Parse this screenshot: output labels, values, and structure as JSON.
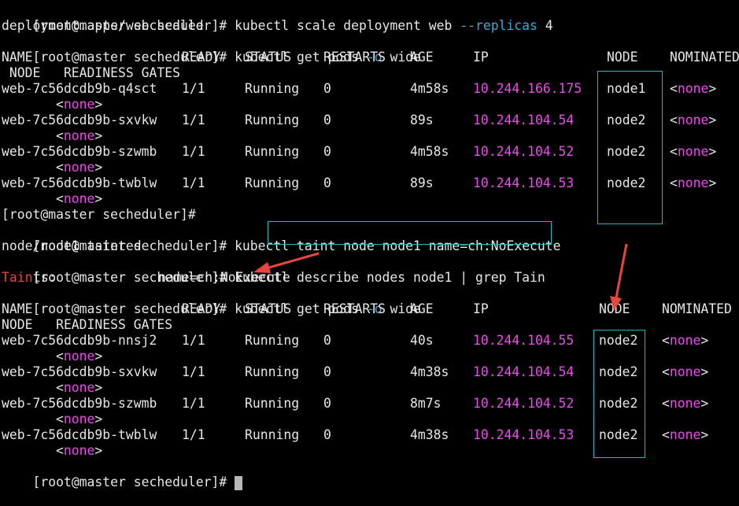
{
  "prompt": "[root@master secheduler]# ",
  "cmd1": "kubectl scale deployment web ",
  "cmd1_flag": "--replicas",
  "cmd1_arg": " 4",
  "out1": "deployment.apps/web scaled",
  "cmd2_a": "kubectl get pods ",
  "cmd2_flag": "-o",
  "cmd2_b": " wide",
  "header": {
    "name": "NAME",
    "ready": "READY",
    "status": "STATUS",
    "restarts": "RESTARTS",
    "age": "AGE",
    "ip": "IP",
    "node": "NODE",
    "nominated": "NOMINATED",
    "node2_top": " NODE   READINESS GATES",
    "node2_bottom": "NODE   READINESS GATES"
  },
  "table1": [
    {
      "name": "web-7c56dcdb9b-q4sct",
      "ready": "1/1",
      "status": "Running",
      "restarts": "0",
      "age": "4m58s",
      "ip": "10.244.166.175",
      "node": "node1",
      "nominated": "none"
    },
    {
      "name": "web-7c56dcdb9b-sxvkw",
      "ready": "1/1",
      "status": "Running",
      "restarts": "0",
      "age": "89s",
      "ip": "10.244.104.54",
      "node": "node2",
      "nominated": "none"
    },
    {
      "name": "web-7c56dcdb9b-szwmb",
      "ready": "1/1",
      "status": "Running",
      "restarts": "0",
      "age": "4m58s",
      "ip": "10.244.104.52",
      "node": "node2",
      "nominated": "none"
    },
    {
      "name": "web-7c56dcdb9b-twblw",
      "ready": "1/1",
      "status": "Running",
      "restarts": "0",
      "age": "89s",
      "ip": "10.244.104.53",
      "node": "node2",
      "nominated": "none"
    }
  ],
  "readiness_none": "none",
  "cmd3_a": "kubectl ",
  "cmd3_b": "taint node node1 name=ch:NoExecute",
  "out3": "node/node1 tainted",
  "cmd4": "kubectl describe nodes node1 | grep Tain",
  "taint_label_red": "Tain",
  "taint_label_rest": "ts:",
  "taint_value": "name=ch:NoExecute",
  "table2": [
    {
      "name": "web-7c56dcdb9b-nnsj2",
      "ready": "1/1",
      "status": "Running",
      "restarts": "0",
      "age": "40s",
      "ip": "10.244.104.55",
      "node": "node2",
      "nominated": "none"
    },
    {
      "name": "web-7c56dcdb9b-sxvkw",
      "ready": "1/1",
      "status": "Running",
      "restarts": "0",
      "age": "4m38s",
      "ip": "10.244.104.54",
      "node": "node2",
      "nominated": "none"
    },
    {
      "name": "web-7c56dcdb9b-szwmb",
      "ready": "1/1",
      "status": "Running",
      "restarts": "0",
      "age": "8m7s",
      "ip": "10.244.104.52",
      "node": "node2",
      "nominated": "none"
    },
    {
      "name": "web-7c56dcdb9b-twblw",
      "ready": "1/1",
      "status": "Running",
      "restarts": "0",
      "age": "4m38s",
      "ip": "10.244.104.53",
      "node": "node2",
      "nominated": "none"
    }
  ],
  "colors": {
    "background": "#000000",
    "text": "#e6e6e6",
    "ip": "#e94ce9",
    "flag": "#3aa9d6",
    "highlight_box": "#27b8bd",
    "arrow": "#e8453c"
  }
}
